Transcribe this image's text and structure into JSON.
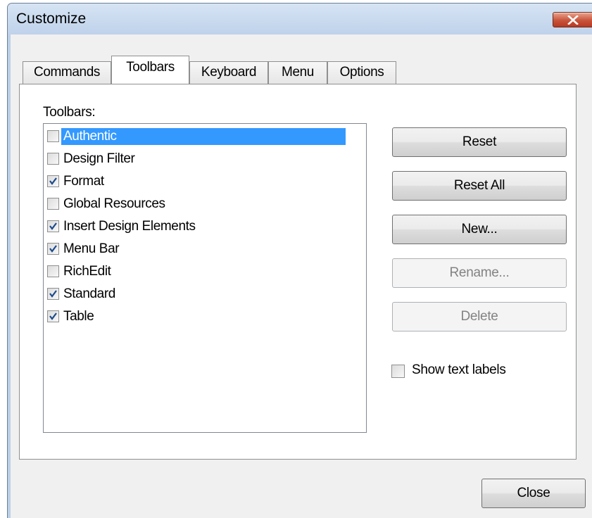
{
  "window": {
    "title": "Customize",
    "close_icon": "close-x-icon",
    "close_button_color": "#c8533a"
  },
  "tabs": [
    {
      "label": "Commands",
      "active": false
    },
    {
      "label": "Toolbars",
      "active": true
    },
    {
      "label": "Keyboard",
      "active": false
    },
    {
      "label": "Menu",
      "active": false
    },
    {
      "label": "Options",
      "active": false
    }
  ],
  "toolbars_section": {
    "label": "Toolbars:",
    "items": [
      {
        "label": "Authentic",
        "checked": false,
        "selected": true
      },
      {
        "label": "Design Filter",
        "checked": false,
        "selected": false
      },
      {
        "label": "Format",
        "checked": true,
        "selected": false
      },
      {
        "label": "Global Resources",
        "checked": false,
        "selected": false
      },
      {
        "label": "Insert Design Elements",
        "checked": true,
        "selected": false
      },
      {
        "label": "Menu Bar",
        "checked": true,
        "selected": false
      },
      {
        "label": "RichEdit",
        "checked": false,
        "selected": false
      },
      {
        "label": "Standard",
        "checked": true,
        "selected": false
      },
      {
        "label": "Table",
        "checked": true,
        "selected": false
      }
    ],
    "selection_color": "#3399ff",
    "check_color": "#1c4a8c"
  },
  "buttons": {
    "reset": {
      "label": "Reset",
      "enabled": true
    },
    "reset_all": {
      "label": "Reset All",
      "enabled": true
    },
    "new": {
      "label": "New...",
      "enabled": true
    },
    "rename": {
      "label": "Rename...",
      "enabled": false
    },
    "delete": {
      "label": "Delete",
      "enabled": false
    },
    "close": {
      "label": "Close",
      "enabled": true
    }
  },
  "show_text_labels": {
    "label": "Show text labels",
    "checked": false
  }
}
